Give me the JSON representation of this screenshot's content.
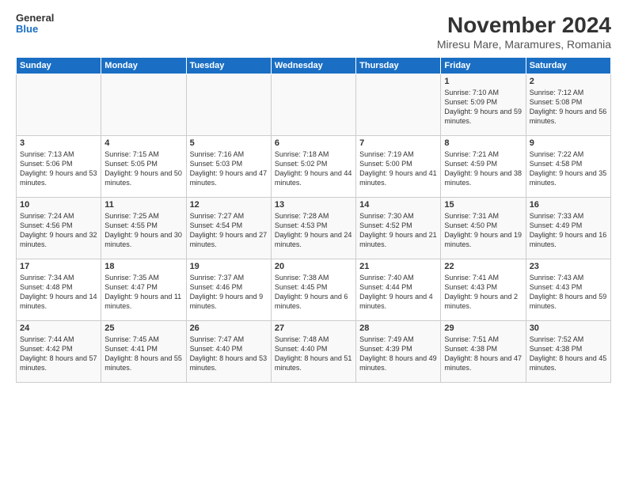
{
  "logo": {
    "line1": "General",
    "line2": "Blue"
  },
  "title": "November 2024",
  "subtitle": "Miresu Mare, Maramures, Romania",
  "weekdays": [
    "Sunday",
    "Monday",
    "Tuesday",
    "Wednesday",
    "Thursday",
    "Friday",
    "Saturday"
  ],
  "weeks": [
    [
      {
        "day": "",
        "info": ""
      },
      {
        "day": "",
        "info": ""
      },
      {
        "day": "",
        "info": ""
      },
      {
        "day": "",
        "info": ""
      },
      {
        "day": "",
        "info": ""
      },
      {
        "day": "1",
        "info": "Sunrise: 7:10 AM\nSunset: 5:09 PM\nDaylight: 9 hours and 59 minutes."
      },
      {
        "day": "2",
        "info": "Sunrise: 7:12 AM\nSunset: 5:08 PM\nDaylight: 9 hours and 56 minutes."
      }
    ],
    [
      {
        "day": "3",
        "info": "Sunrise: 7:13 AM\nSunset: 5:06 PM\nDaylight: 9 hours and 53 minutes."
      },
      {
        "day": "4",
        "info": "Sunrise: 7:15 AM\nSunset: 5:05 PM\nDaylight: 9 hours and 50 minutes."
      },
      {
        "day": "5",
        "info": "Sunrise: 7:16 AM\nSunset: 5:03 PM\nDaylight: 9 hours and 47 minutes."
      },
      {
        "day": "6",
        "info": "Sunrise: 7:18 AM\nSunset: 5:02 PM\nDaylight: 9 hours and 44 minutes."
      },
      {
        "day": "7",
        "info": "Sunrise: 7:19 AM\nSunset: 5:00 PM\nDaylight: 9 hours and 41 minutes."
      },
      {
        "day": "8",
        "info": "Sunrise: 7:21 AM\nSunset: 4:59 PM\nDaylight: 9 hours and 38 minutes."
      },
      {
        "day": "9",
        "info": "Sunrise: 7:22 AM\nSunset: 4:58 PM\nDaylight: 9 hours and 35 minutes."
      }
    ],
    [
      {
        "day": "10",
        "info": "Sunrise: 7:24 AM\nSunset: 4:56 PM\nDaylight: 9 hours and 32 minutes."
      },
      {
        "day": "11",
        "info": "Sunrise: 7:25 AM\nSunset: 4:55 PM\nDaylight: 9 hours and 30 minutes."
      },
      {
        "day": "12",
        "info": "Sunrise: 7:27 AM\nSunset: 4:54 PM\nDaylight: 9 hours and 27 minutes."
      },
      {
        "day": "13",
        "info": "Sunrise: 7:28 AM\nSunset: 4:53 PM\nDaylight: 9 hours and 24 minutes."
      },
      {
        "day": "14",
        "info": "Sunrise: 7:30 AM\nSunset: 4:52 PM\nDaylight: 9 hours and 21 minutes."
      },
      {
        "day": "15",
        "info": "Sunrise: 7:31 AM\nSunset: 4:50 PM\nDaylight: 9 hours and 19 minutes."
      },
      {
        "day": "16",
        "info": "Sunrise: 7:33 AM\nSunset: 4:49 PM\nDaylight: 9 hours and 16 minutes."
      }
    ],
    [
      {
        "day": "17",
        "info": "Sunrise: 7:34 AM\nSunset: 4:48 PM\nDaylight: 9 hours and 14 minutes."
      },
      {
        "day": "18",
        "info": "Sunrise: 7:35 AM\nSunset: 4:47 PM\nDaylight: 9 hours and 11 minutes."
      },
      {
        "day": "19",
        "info": "Sunrise: 7:37 AM\nSunset: 4:46 PM\nDaylight: 9 hours and 9 minutes."
      },
      {
        "day": "20",
        "info": "Sunrise: 7:38 AM\nSunset: 4:45 PM\nDaylight: 9 hours and 6 minutes."
      },
      {
        "day": "21",
        "info": "Sunrise: 7:40 AM\nSunset: 4:44 PM\nDaylight: 9 hours and 4 minutes."
      },
      {
        "day": "22",
        "info": "Sunrise: 7:41 AM\nSunset: 4:43 PM\nDaylight: 9 hours and 2 minutes."
      },
      {
        "day": "23",
        "info": "Sunrise: 7:43 AM\nSunset: 4:43 PM\nDaylight: 8 hours and 59 minutes."
      }
    ],
    [
      {
        "day": "24",
        "info": "Sunrise: 7:44 AM\nSunset: 4:42 PM\nDaylight: 8 hours and 57 minutes."
      },
      {
        "day": "25",
        "info": "Sunrise: 7:45 AM\nSunset: 4:41 PM\nDaylight: 8 hours and 55 minutes."
      },
      {
        "day": "26",
        "info": "Sunrise: 7:47 AM\nSunset: 4:40 PM\nDaylight: 8 hours and 53 minutes."
      },
      {
        "day": "27",
        "info": "Sunrise: 7:48 AM\nSunset: 4:40 PM\nDaylight: 8 hours and 51 minutes."
      },
      {
        "day": "28",
        "info": "Sunrise: 7:49 AM\nSunset: 4:39 PM\nDaylight: 8 hours and 49 minutes."
      },
      {
        "day": "29",
        "info": "Sunrise: 7:51 AM\nSunset: 4:38 PM\nDaylight: 8 hours and 47 minutes."
      },
      {
        "day": "30",
        "info": "Sunrise: 7:52 AM\nSunset: 4:38 PM\nDaylight: 8 hours and 45 minutes."
      }
    ]
  ]
}
